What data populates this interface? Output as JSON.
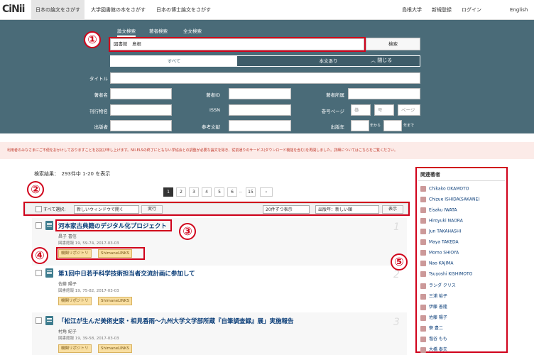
{
  "header": {
    "logo": "CiNii",
    "tabs": [
      "日本の論文をさがす",
      "大学図書館の本をさがす",
      "日本の博士論文をさがす"
    ],
    "right": [
      "島根大学",
      "新規登録",
      "ログイン",
      "English"
    ]
  },
  "search": {
    "tabs": [
      "論文検索",
      "著者検索",
      "全文検索"
    ],
    "query": "図書館　島根",
    "button": "検索",
    "toggle_all": "すべて",
    "toggle_fulltext": "本文あり",
    "close": "閉じる",
    "labels": {
      "title": "タイトル",
      "author": "著者名",
      "author_id": "著者ID",
      "affiliation": "著者所属",
      "journal": "刊行物名",
      "issn": "ISSN",
      "vol_page": "巻号ページ",
      "publisher": "出版者",
      "ref": "参考文献",
      "year": "出版年"
    },
    "placeholders": {
      "vol": "巻",
      "no": "号",
      "page": "ページ"
    },
    "year_from": "年から",
    "year_to": "年まで"
  },
  "notice": "利用者のみなさまにご不便をおかけしておりますことをお詫び申し上げます。NII-ELSの終了にともない学協会との調整が必要な論文を除き、従前通りのサービス(ダウンロード機能を含む)を再開しました。詳細についてはこちらをご覧ください。",
  "results": {
    "summary": "検索結果：　293件中 1-20 を表示",
    "pages": [
      "1",
      "2",
      "3",
      "4",
      "5",
      "6",
      "..",
      "15",
      "›"
    ],
    "select_all": "すべて選択:",
    "window_option": "新しいウィンドウで開く",
    "run": "実行",
    "per_page": "20件ずつ表示",
    "sort": "出版年：新しい順",
    "show": "表示",
    "items": [
      {
        "title": "河本家古典籍のデジタル化プロジェクト",
        "author": "昌子 喜信",
        "source": "図書館報 19, 59-74, 2017-03-03",
        "badges": [
          "機関リポジトリ",
          "ShimaneLINKS"
        ],
        "num": "1"
      },
      {
        "title": "第1回中日若手科学技術担当者交流計画に参加して",
        "author": "佐藤 陽子",
        "source": "図書館報 19, 75-82, 2017-03-03",
        "badges": [
          "機関リポジトリ",
          "ShimaneLINKS"
        ],
        "num": "2"
      },
      {
        "title": "「松江が生んだ美術史家・相見香雨～九州大学文学部所蔵『自筆調査録』展」実施報告",
        "author": "村角 紀子",
        "source": "図書館報 19, 39-58, 2017-03-03",
        "badges": [
          "機関リポジトリ",
          "ShimaneLINKS"
        ],
        "num": "3"
      }
    ]
  },
  "sidebar": {
    "title": "関連著者",
    "authors": [
      "Chikako OKAMOTO",
      "Chizue ISHIDA(SAKANE)",
      "Eisaku IWATA",
      "Hiroyuki NAORA",
      "Jun TAKAHASHI",
      "Maya TAKEDA",
      "Momo SHIOYA",
      "Nao KAJIMA",
      "Tsuyoshi KISHIMOTO",
      "ランダ クリス",
      "三浦 裕子",
      "伊藤 善隆",
      "佐藤 陽子",
      "寮 豊二",
      "塩谷 もも",
      "大橋 泰夫"
    ]
  },
  "annotations": [
    "①",
    "②",
    "③",
    "④",
    "⑤"
  ]
}
